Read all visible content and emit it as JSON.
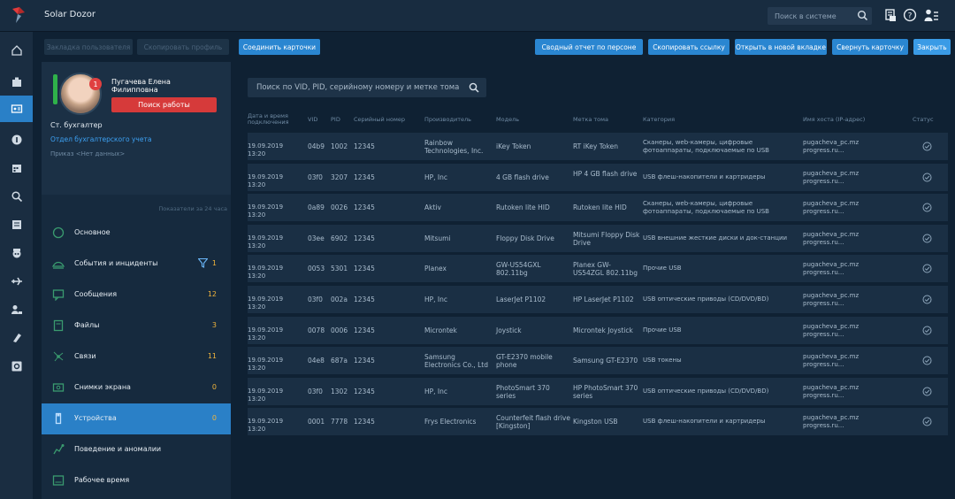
{
  "app": {
    "title": "Solar Dozor"
  },
  "search_system": {
    "placeholder": "Поиск в системе"
  },
  "toolbar": {
    "disabled_1": "Закладка пользователя",
    "disabled_2": "Скопировать профиль",
    "merge_cards": "Соединить карточки",
    "summary_report": "Сводный отчет по персоне",
    "copy_link": "Скопировать ссылку",
    "open_new_tab": "Открыть в новой вкладке",
    "collapse_card": "Свернуть карточку",
    "close": "Закрыть"
  },
  "profile": {
    "name": "Пугачева Елена Филипповна",
    "badge": "1",
    "job_search": "Поиск работы",
    "position": "Ст. бухгалтер",
    "department": "Отдел бухгалтерского учета",
    "order": "Приказ <Нет данных>"
  },
  "indicators_label": "Показатели за 24 часа",
  "categories": [
    {
      "label": "Основное",
      "count": ""
    },
    {
      "label": "События и инциденты",
      "count": "1"
    },
    {
      "label": "Сообщения",
      "count": "12"
    },
    {
      "label": "Файлы",
      "count": "3"
    },
    {
      "label": "Связи",
      "count": "11"
    },
    {
      "label": "Снимки экрана",
      "count": "0"
    },
    {
      "label": "Устройства",
      "count": "0"
    },
    {
      "label": "Поведение и аномалии",
      "count": ""
    },
    {
      "label": "Рабочее время",
      "count": ""
    }
  ],
  "device_search": {
    "placeholder": "Поиск по VID, PID, серийному номеру и метке тома"
  },
  "table": {
    "columns": [
      "Дата и время подключения",
      "VID",
      "PID",
      "Серийный номер",
      "Производитель",
      "Модель",
      "Метка тома",
      "Категория",
      "Имя хоста (IP-адрес)",
      "Статус"
    ],
    "rows": [
      [
        "19.09.2019 13:20",
        "04b9",
        "1002",
        "12345",
        "Rainbow Technologies, Inc.",
        "iKey Token",
        "RT iKey Token",
        "Сканеры, web-камеры, цифровые фотоаппараты, подключаемые по USB",
        "pugacheva_pc.mz progress.ru..."
      ],
      [
        "19.09.2019 13:20",
        "03f0",
        "3207",
        "12345",
        "HP, Inc",
        "4 GB flash drive",
        "HP 4 GB flash drive",
        "USB флеш-накопители и картридеры",
        "pugacheva_pc.mz progress.ru..."
      ],
      [
        "19.09.2019 13:20",
        "0a89",
        "0026",
        "12345",
        "Aktiv",
        "Rutoken lite HID",
        "Rutoken lite HID",
        "Сканеры, web-камеры, цифровые фотоаппараты, подключаемые по USB",
        "pugacheva_pc.mz progress.ru..."
      ],
      [
        "19.09.2019 13:20",
        "03ee",
        "6902",
        "12345",
        "Mitsumi",
        "Floppy Disk Drive",
        "Mitsumi Floppy Disk Drive",
        "USB внешние жесткие диски и док-станции",
        "pugacheva_pc.mz progress.ru..."
      ],
      [
        "19.09.2019 13:20",
        "0053",
        "5301",
        "12345",
        "Planex",
        "GW-US54GXL 802.11bg",
        "Planex GW-US54ZGL 802.11bg",
        "Прочие USB",
        "pugacheva_pc.mz progress.ru..."
      ],
      [
        "19.09.2019 13:20",
        "03f0",
        "002a",
        "12345",
        "HP, Inc",
        "LaserJet P1102",
        "HP LaserJet P1102",
        "USB оптические приводы (CD/DVD/BD)",
        "pugacheva_pc.mz progress.ru..."
      ],
      [
        "19.09.2019 13:20",
        "0078",
        "0006",
        "12345",
        "Microntek",
        "Joystick",
        "Microntek Joystick",
        "Прочие USB",
        "pugacheva_pc.mz progress.ru..."
      ],
      [
        "19.09.2019 13:20",
        "04e8",
        "687a",
        "12345",
        "Samsung Electronics Co., Ltd",
        "GT-E2370 mobile phone",
        "Samsung GT-E2370",
        "USB токены",
        "pugacheva_pc.mz progress.ru..."
      ],
      [
        "19.09.2019 13:20",
        "03f0",
        "1302",
        "12345",
        "HP, Inc",
        "PhotoSmart 370 series",
        "HP PhotoSmart 370 series",
        "USB оптические приводы (CD/DVD/BD)",
        "pugacheva_pc.mz progress.ru..."
      ],
      [
        "19.09.2019 13:20",
        "0001",
        "7778",
        "12345",
        "Frys Electronics",
        "Counterfeit flash drive [Kingston]",
        "Kingston USB",
        "USB флеш-накопители и картридеры",
        "pugacheva_pc.mz progress.ru..."
      ]
    ]
  },
  "colors": {
    "accent": "#2a86d1",
    "danger": "#d63a3a",
    "count": "#f0b43c",
    "link": "#3da2f5"
  }
}
